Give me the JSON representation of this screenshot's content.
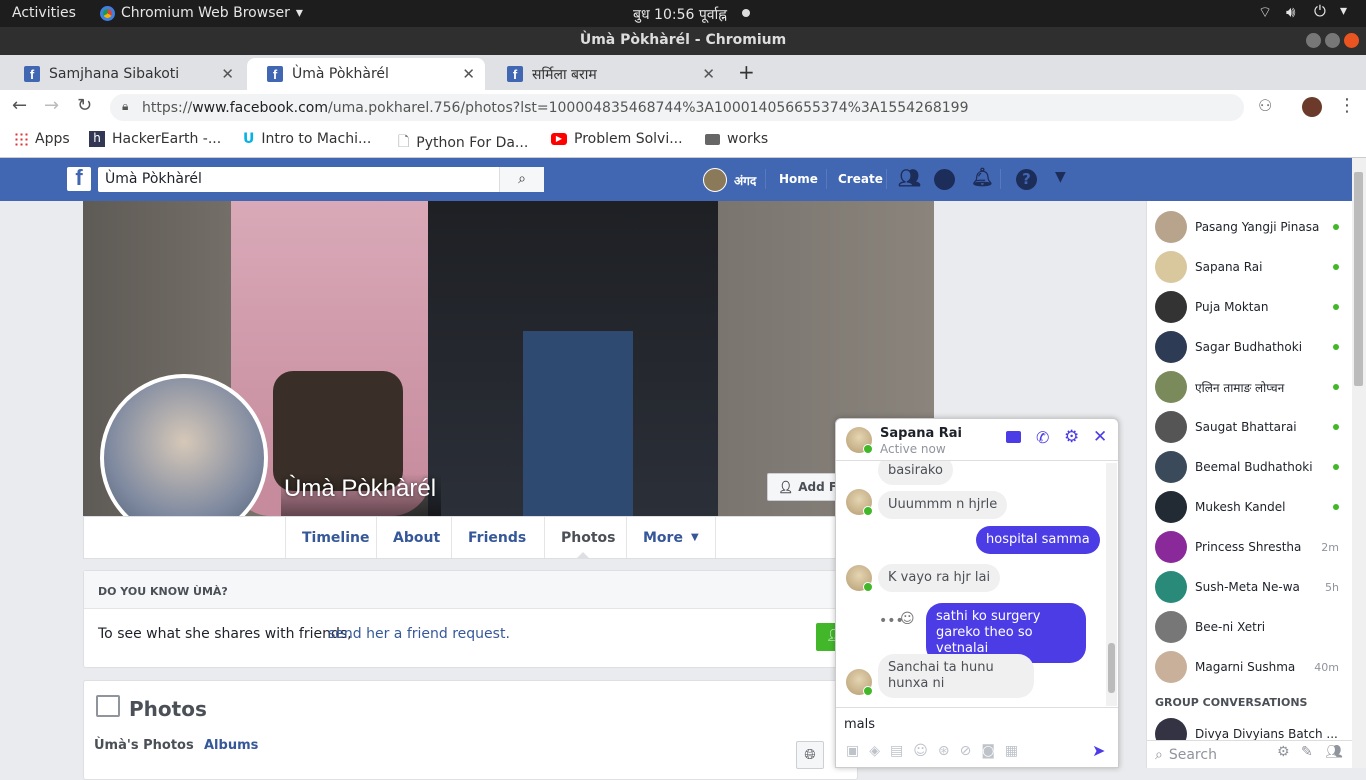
{
  "os": {
    "activities": "Activities",
    "app_menu": "Chromium Web Browser",
    "clock": "बुध 10:56 पूर्वाह्न",
    "window_title": "Ùmà Pòkhàrél - Chromium"
  },
  "tabs": [
    {
      "label": "Samjhana Sibakoti"
    },
    {
      "label": "Ùmà Pòkhàrél"
    },
    {
      "label": "सर्मिला बराम"
    }
  ],
  "address": {
    "scheme": "https://",
    "host": "www.facebook.com",
    "path": "/uma.pokharel.756/photos?lst=100004835468744%3A100014056655374%3A1554268199"
  },
  "bookmarks": [
    {
      "label": "Apps"
    },
    {
      "label": "HackerEarth -..."
    },
    {
      "label": "Intro to Machi..."
    },
    {
      "label": "Python For Da..."
    },
    {
      "label": "Problem Solvi..."
    },
    {
      "label": "works"
    }
  ],
  "fb": {
    "search_value": "Ùmà Pòkhàrél",
    "user_name": "अंगद",
    "home": "Home",
    "create": "Create"
  },
  "profile": {
    "name": "Ùmà Pòkhàrél",
    "add_friend": "Add Fri",
    "nav": [
      "Timeline",
      "About",
      "Friends",
      "Photos",
      "More"
    ]
  },
  "know": {
    "heading": "DO YOU KNOW ÙMÀ?",
    "text": "To see what she shares with friends,",
    "link": "send her a friend request."
  },
  "photos": {
    "title": "Photos",
    "tab1": "Ùmà's Photos",
    "tab2": "Albums"
  },
  "chat": {
    "name": "Sapana Rai",
    "status": "Active now",
    "messages": [
      {
        "from": "them",
        "text": "basirako"
      },
      {
        "from": "them",
        "text": "Uuummm n hjrle"
      },
      {
        "from": "me",
        "text": "hospital samma"
      },
      {
        "from": "them",
        "text": "K vayo ra hjr lai"
      },
      {
        "from": "me",
        "text": "sathi ko surgery gareko theo so vetnalai"
      },
      {
        "from": "them",
        "text": "Sanchai ta hunu hunxa ni"
      }
    ],
    "input_value": "mals"
  },
  "contacts": [
    {
      "name": "Pasang Yangji Pinasa",
      "status": "online",
      "color": "#b8a48c"
    },
    {
      "name": "Sapana Rai",
      "status": "online",
      "color": "#d9c79d"
    },
    {
      "name": "Puja Moktan",
      "status": "online",
      "color": "#333333"
    },
    {
      "name": "Sagar Budhathoki",
      "status": "online",
      "color": "#2e3b55"
    },
    {
      "name": "एलिन तामाङ लोप्चन",
      "status": "online",
      "color": "#7a8a5a"
    },
    {
      "name": "Saugat Bhattarai",
      "status": "online",
      "color": "#555555"
    },
    {
      "name": "Beemal Budhathoki",
      "status": "online",
      "color": "#3a4a5a"
    },
    {
      "name": "Mukesh Kandel",
      "status": "online",
      "color": "#222a33"
    },
    {
      "name": "Princess Shrestha",
      "status": "2m",
      "color": "#8a2a9a"
    },
    {
      "name": "Sush-Meta Ne-wa",
      "status": "5h",
      "color": "#2a8a7a"
    },
    {
      "name": "Bee-ni Xetri",
      "status": "",
      "color": "#777777"
    },
    {
      "name": "Magarni Sushma",
      "status": "40m",
      "color": "#c9b09a"
    }
  ],
  "group_heading": "GROUP CONVERSATIONS",
  "group_item": "Divya Divyians Batch ...",
  "sidebar_search": "Search",
  "colors": {
    "fb_blue": "#4267b2",
    "messenger": "#4c3ce6",
    "online": "#42b72a"
  }
}
